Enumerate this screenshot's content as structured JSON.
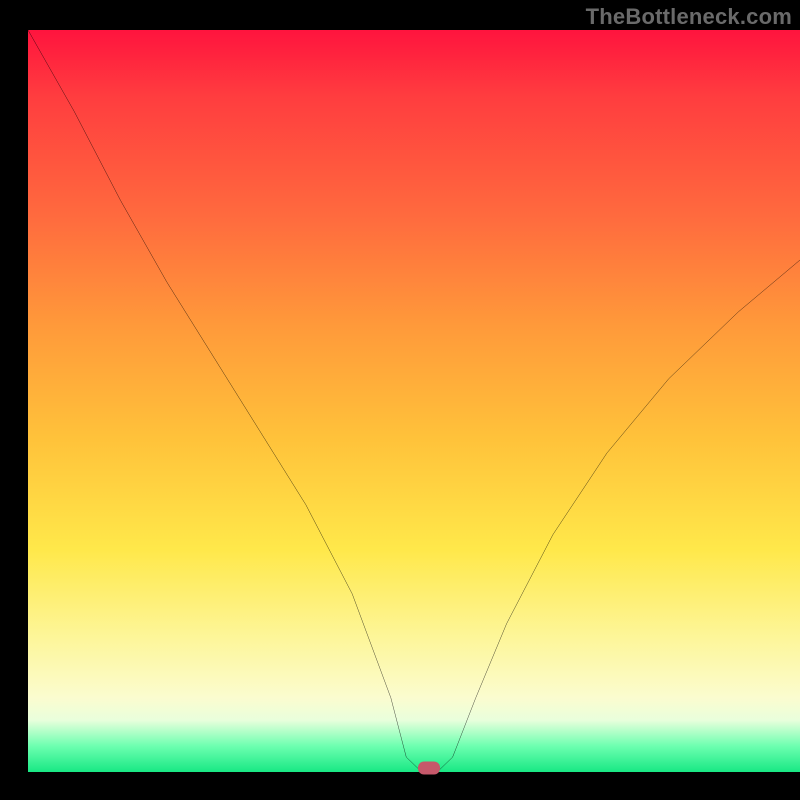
{
  "watermark": "TheBottleneck.com",
  "chart_data": {
    "type": "line",
    "title": "",
    "xlabel": "",
    "ylabel": "",
    "xlim": [
      0,
      100
    ],
    "ylim": [
      0,
      100
    ],
    "grid": false,
    "legend": false,
    "series": [
      {
        "name": "curve",
        "x": [
          0,
          6,
          12,
          18,
          24,
          30,
          36,
          42,
          47,
          49,
          51,
          53,
          55,
          58,
          62,
          68,
          75,
          83,
          92,
          100
        ],
        "values": [
          100,
          89,
          77,
          66,
          56,
          46,
          36,
          24,
          10,
          2,
          0,
          0,
          2,
          10,
          20,
          32,
          43,
          53,
          62,
          69
        ]
      }
    ],
    "marker": {
      "x": 52,
      "y": 0.5
    },
    "background_gradient": {
      "stops": [
        {
          "pos": 0,
          "color": "#ff143e"
        },
        {
          "pos": 0.25,
          "color": "#ff6a3e"
        },
        {
          "pos": 0.55,
          "color": "#ffc23a"
        },
        {
          "pos": 0.82,
          "color": "#fdf69a"
        },
        {
          "pos": 0.96,
          "color": "#6dffb0"
        },
        {
          "pos": 1.0,
          "color": "#18e884"
        }
      ]
    }
  }
}
